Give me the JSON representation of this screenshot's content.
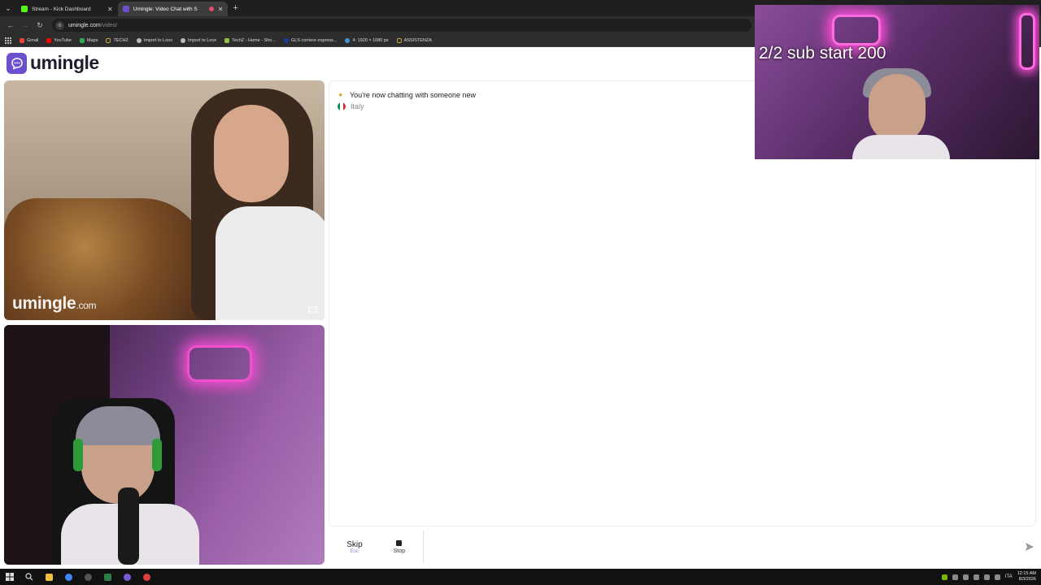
{
  "browser": {
    "tabs": [
      {
        "title": "Stream - Kick Dashboard",
        "active": false,
        "favicon_color": "#53fc18"
      },
      {
        "title": "Umingle: Video Chat with S",
        "active": true,
        "favicon_color": "#6b4fcf",
        "recording": true
      }
    ],
    "address": {
      "domain": "umingle.com",
      "path": "/video/"
    },
    "bookmarks": [
      {
        "label": "Gmail",
        "color": "#ea4335"
      },
      {
        "label": "YouTube",
        "color": "#ff0000"
      },
      {
        "label": "Maps",
        "color": "#34a853"
      },
      {
        "label": "TECHZ",
        "color": "#c8a04a"
      },
      {
        "label": "Import to Loox",
        "color": "#bbbbbb"
      },
      {
        "label": "Import to Loox",
        "color": "#bbbbbb"
      },
      {
        "label": "TechZ - Home - Sho...",
        "color": "#95bf47"
      },
      {
        "label": "GLS corriere espress...",
        "color": "#1a3d8f"
      },
      {
        "label": "4: 1920 × 1080 px",
        "color": "#4a90d9"
      },
      {
        "label": "ASSISTENZA",
        "color": "#c8a04a"
      }
    ]
  },
  "site": {
    "logo_text": "umingle",
    "brand_color": "#6b4fcf",
    "watermark": {
      "main": "umingle",
      "suffix": ".com"
    }
  },
  "chat": {
    "system_message": "You're now chatting with someone new",
    "country": "Italy",
    "input_value": ""
  },
  "controls": {
    "skip_label": "Skip",
    "skip_key": "Esc",
    "stop_label": "Stop"
  },
  "overlay": {
    "text": "2/2 sub start 200"
  },
  "taskbar": {
    "lang": "ITA",
    "time": "12:15 AM",
    "date": "8/3/2026"
  }
}
